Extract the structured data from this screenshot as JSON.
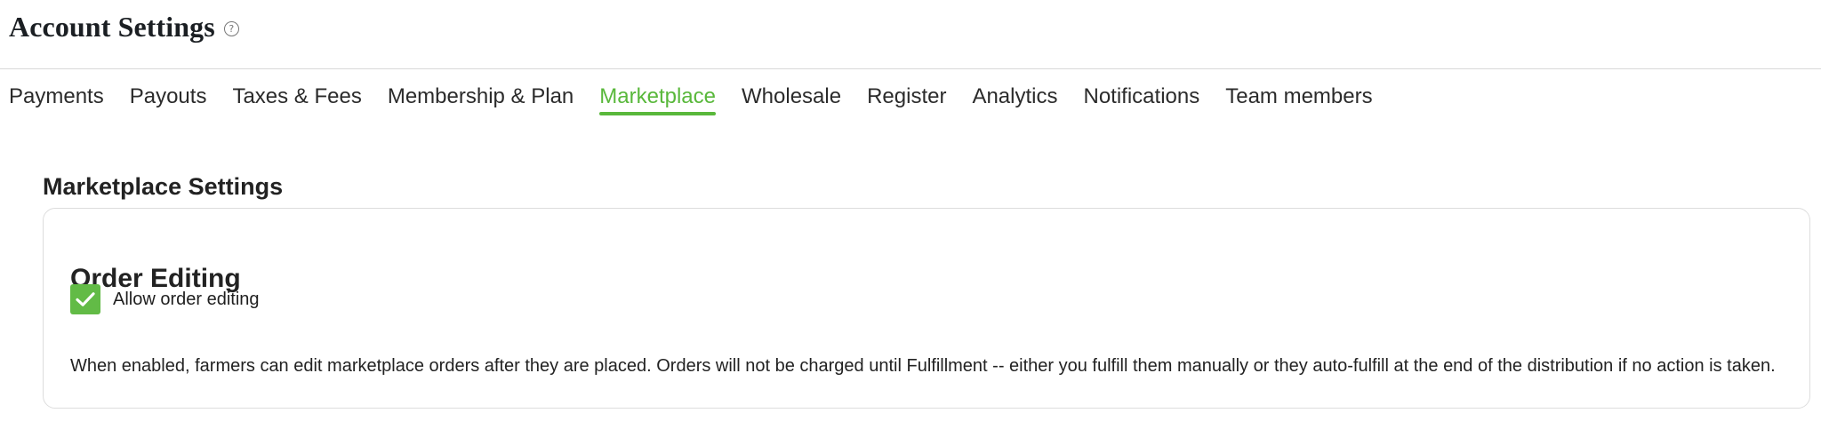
{
  "header": {
    "title": "Account Settings",
    "help_icon": "question-circle-icon"
  },
  "tabs": [
    {
      "label": "Payments",
      "active": false
    },
    {
      "label": "Payouts",
      "active": false
    },
    {
      "label": "Taxes & Fees",
      "active": false
    },
    {
      "label": "Membership & Plan",
      "active": false
    },
    {
      "label": "Marketplace",
      "active": true
    },
    {
      "label": "Wholesale",
      "active": false
    },
    {
      "label": "Register",
      "active": false
    },
    {
      "label": "Analytics",
      "active": false
    },
    {
      "label": "Notifications",
      "active": false
    },
    {
      "label": "Team members",
      "active": false
    }
  ],
  "section": {
    "title": "Marketplace Settings"
  },
  "order_editing": {
    "title": "Order Editing",
    "checkbox_label": "Allow order editing",
    "checked": true,
    "description": "When enabled, farmers can edit marketplace orders after they are placed. Orders will not be charged until Fulfillment -- either you fulfill them manually or they auto-fulfill at the end of the distribution if no action is taken."
  },
  "colors": {
    "accent": "#59b83b",
    "checkbox": "#62bb46",
    "divider": "#d9d9d9",
    "card_border": "#dddddd"
  },
  "icons": {
    "help": "question-circle-icon",
    "checkmark": "checkmark-icon"
  }
}
